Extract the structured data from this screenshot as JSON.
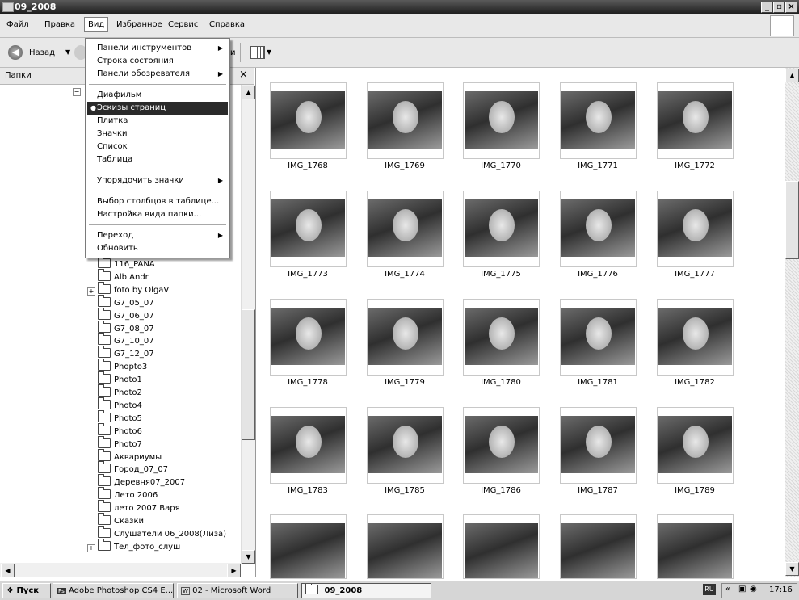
{
  "window": {
    "title": "09_2008"
  },
  "menu": [
    "Файл",
    "Правка",
    "Вид",
    "Избранное",
    "Сервис",
    "Справка"
  ],
  "toolbar": {
    "back_label": "Назад",
    "cut_text": "и"
  },
  "folders_panel": {
    "title": "Папки",
    "items": [
      "116_PANA",
      "Alb Andr",
      "foto by OlgaV",
      "G7_05_07",
      "G7_06_07",
      "G7_08_07",
      "G7_10_07",
      "G7_12_07",
      "Phopto3",
      "Photo1",
      "Photo2",
      "Photo4",
      "Photo5",
      "Photo6",
      "Photo7",
      "Аквариумы",
      "Город_07_07",
      "Деревня07_2007",
      "Лето 2006",
      "лето 2007 Варя",
      "Сказки",
      "Слушатели 06_2008(Лиза)",
      "Тел_фото_слуш"
    ]
  },
  "view_menu": {
    "group1": [
      "Панели инструментов",
      "Строка состояния",
      "Панели обозревателя"
    ],
    "group2": [
      "Диафильм",
      "Эскизы страниц",
      "Плитка",
      "Значки",
      "Список",
      "Таблица"
    ],
    "group3": [
      "Упорядочить значки"
    ],
    "group4": [
      "Выбор столбцов в таблице...",
      "Настройка вида папки..."
    ],
    "group5": [
      "Переход",
      "Обновить"
    ],
    "selected": "Эскизы страниц"
  },
  "thumbnails": [
    "IMG_1768",
    "IMG_1769",
    "IMG_1770",
    "IMG_1771",
    "IMG_1772",
    "IMG_1773",
    "IMG_1774",
    "IMG_1775",
    "IMG_1776",
    "IMG_1777",
    "IMG_1778",
    "IMG_1779",
    "IMG_1780",
    "IMG_1781",
    "IMG_1782",
    "IMG_1783",
    "IMG_1785",
    "IMG_1786",
    "IMG_1787",
    "IMG_1789"
  ],
  "taskbar": {
    "start": "Пуск",
    "tasks": [
      "Adobe Photoshop CS4 E...",
      "02 - Microsoft Word",
      "09_2008"
    ],
    "lang": "RU",
    "time": "17:16"
  }
}
